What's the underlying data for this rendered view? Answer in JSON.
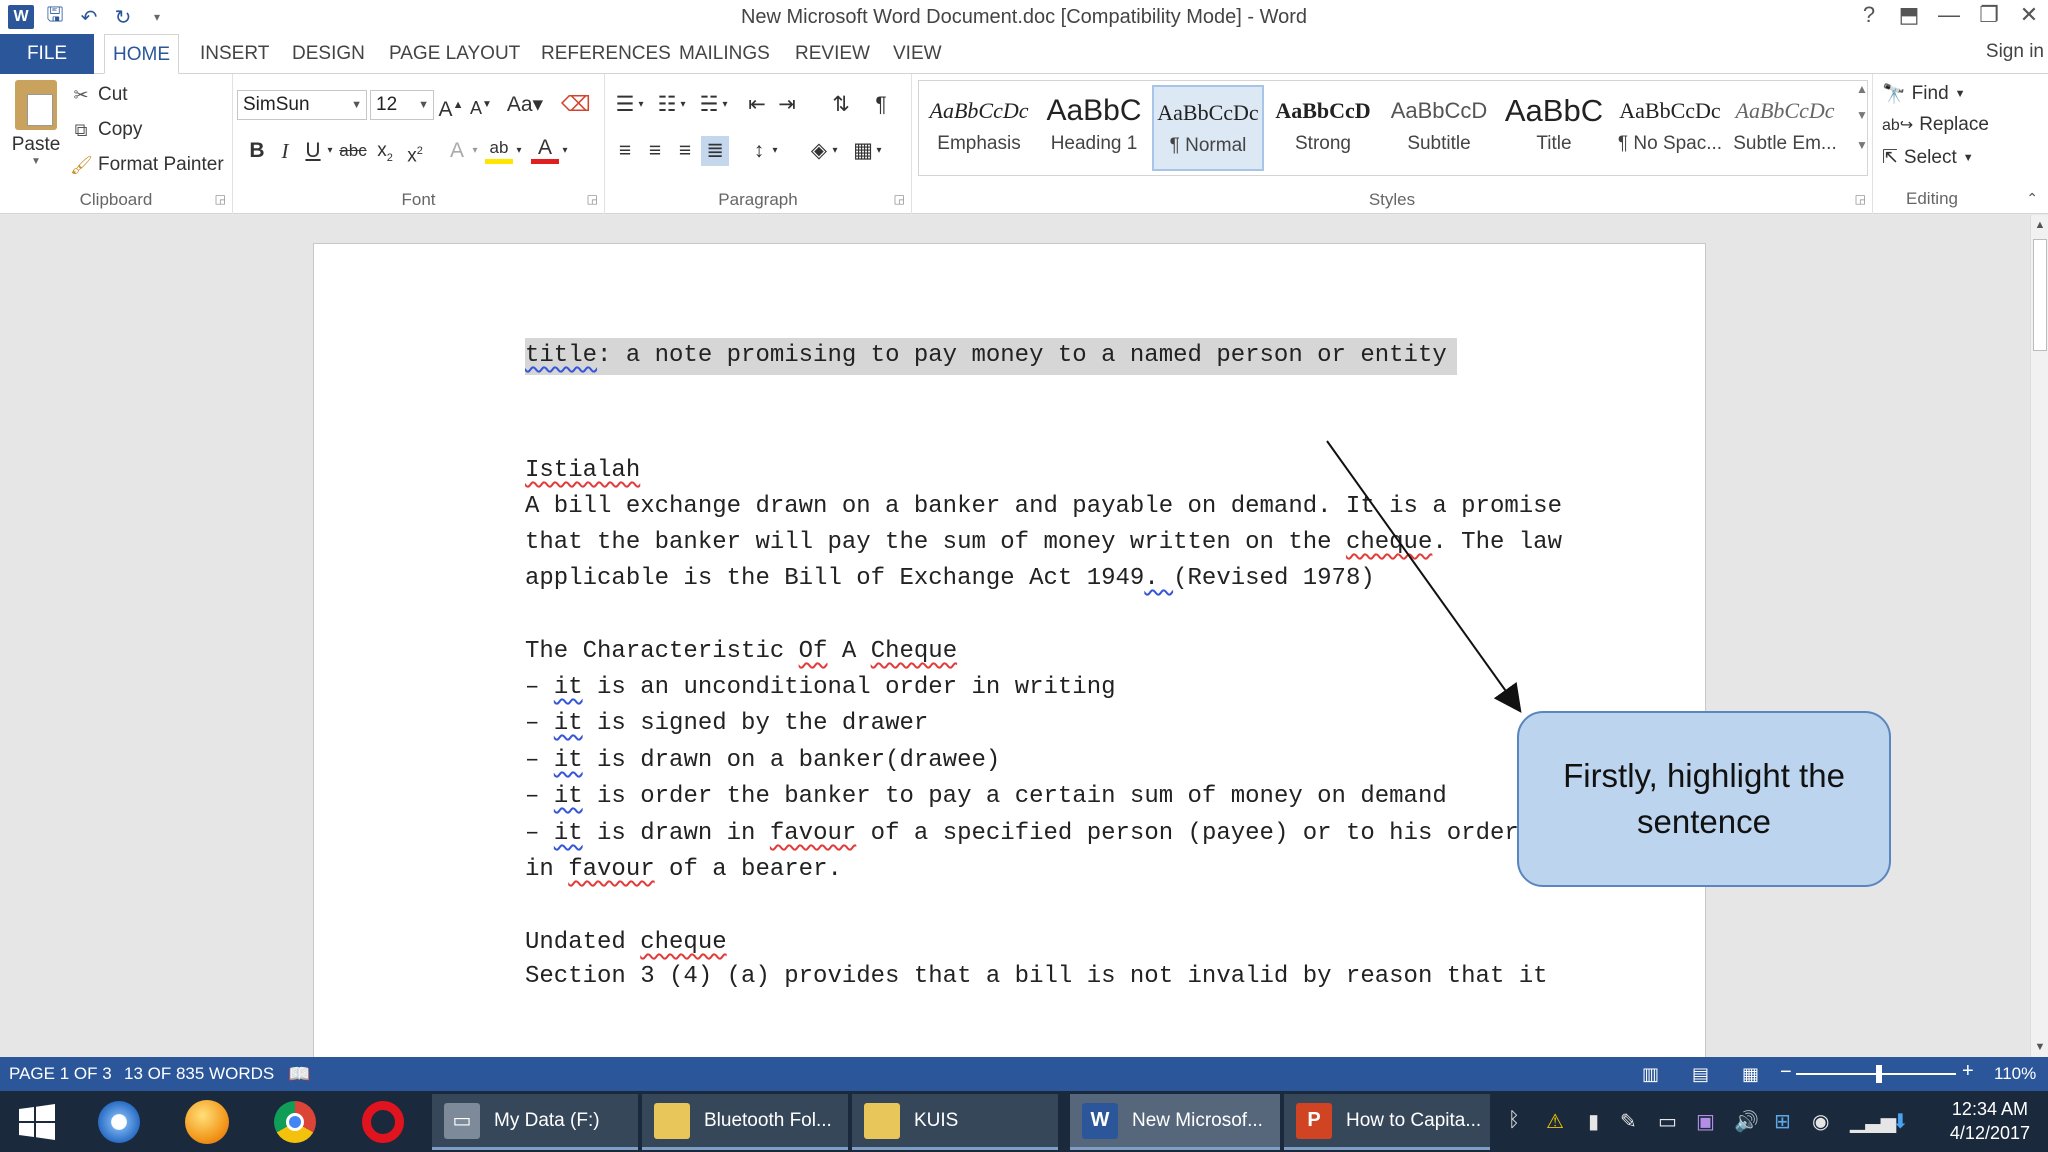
{
  "window": {
    "title": "New Microsoft Word Document.doc [Compatibility Mode] - Word",
    "controls": [
      "?",
      "⬒",
      "—",
      "❐",
      "✕"
    ]
  },
  "tabs": {
    "file": "FILE",
    "items": [
      "HOME",
      "INSERT",
      "DESIGN",
      "PAGE LAYOUT",
      "REFERENCES",
      "MAILINGS",
      "REVIEW",
      "VIEW"
    ],
    "sign_in": "Sign in"
  },
  "ribbon": {
    "clipboard": {
      "label": "Clipboard",
      "paste": "Paste",
      "cut": "Cut",
      "copy": "Copy",
      "format_painter": "Format Painter"
    },
    "font": {
      "label": "Font",
      "font_name": "SimSun",
      "font_size": "12"
    },
    "paragraph": {
      "label": "Paragraph"
    },
    "styles": {
      "label": "Styles",
      "items": [
        {
          "sample": "AaBbCcDc",
          "name": "Emphasis"
        },
        {
          "sample": "AaBbC",
          "name": "Heading 1"
        },
        {
          "sample": "AaBbCcDc",
          "name": "¶ Normal"
        },
        {
          "sample": "AaBbCcD",
          "name": "Strong"
        },
        {
          "sample": "AaBbCcD",
          "name": "Subtitle"
        },
        {
          "sample": "AaBbC",
          "name": "Title"
        },
        {
          "sample": "AaBbCcDc",
          "name": "¶ No Spac..."
        },
        {
          "sample": "AaBbCcDc",
          "name": "Subtle Em..."
        }
      ],
      "selected_index": 2
    },
    "editing": {
      "label": "Editing",
      "find": "Find",
      "replace": "Replace",
      "select": "Select"
    }
  },
  "document": {
    "title_word": "title",
    "title_rest": ": a note promising to pay money to a named person or entity",
    "istialah": "Istialah",
    "p1_l1": "A bill exchange drawn on a banker and payable on demand. It is a promise",
    "p1_l2_a": "that the banker will pay the sum of money written on the ",
    "cheque": "cheque",
    "p1_l2_b": ". The law",
    "p1_l3_a": "applicable is the Bill of Exchange Act 1949",
    "p1_l3_sep": ". ",
    "p1_l3_b": "(Revised 1978)",
    "char_a": "The Characteristic ",
    "of": "Of",
    "char_b": " A ",
    "char_cheque": "Cheque",
    "dash": "– ",
    "it": "it",
    "b1": " is an unconditional order in writing",
    "b2": " is signed by the drawer",
    "b3": " is drawn on a banker(drawee)",
    "b4": " is order the banker to pay a certain sum of money on demand",
    "b5_a": " is drawn in ",
    "favour": "favour",
    "b5_b": " of a specified person (payee) or to his order or",
    "b6_a": "in ",
    "b6_b": " of a bearer.",
    "undated": "Undated ",
    "undated_cheque": "cheque",
    "section": "Section 3 (4) (a) provides that a bill is not invalid by reason that it"
  },
  "callout": {
    "text": "Firstly, highlight the sentence"
  },
  "status": {
    "page": "PAGE 1 OF 3",
    "words": "13 OF 835 WORDS",
    "zoom": "110%"
  },
  "taskbar": {
    "apps": [
      {
        "label": "My Data (F:)"
      },
      {
        "label": "Bluetooth Fol..."
      },
      {
        "label": "KUIS"
      },
      {
        "label": "New Microsof..."
      },
      {
        "label": "How to Capita..."
      }
    ],
    "time": "12:34 AM",
    "date": "4/12/2017"
  },
  "colors": {
    "accent": "#2b579a",
    "callout_fill": "#bcd4ee",
    "callout_border": "#5a86bf",
    "selection": "#d6d6d6"
  }
}
